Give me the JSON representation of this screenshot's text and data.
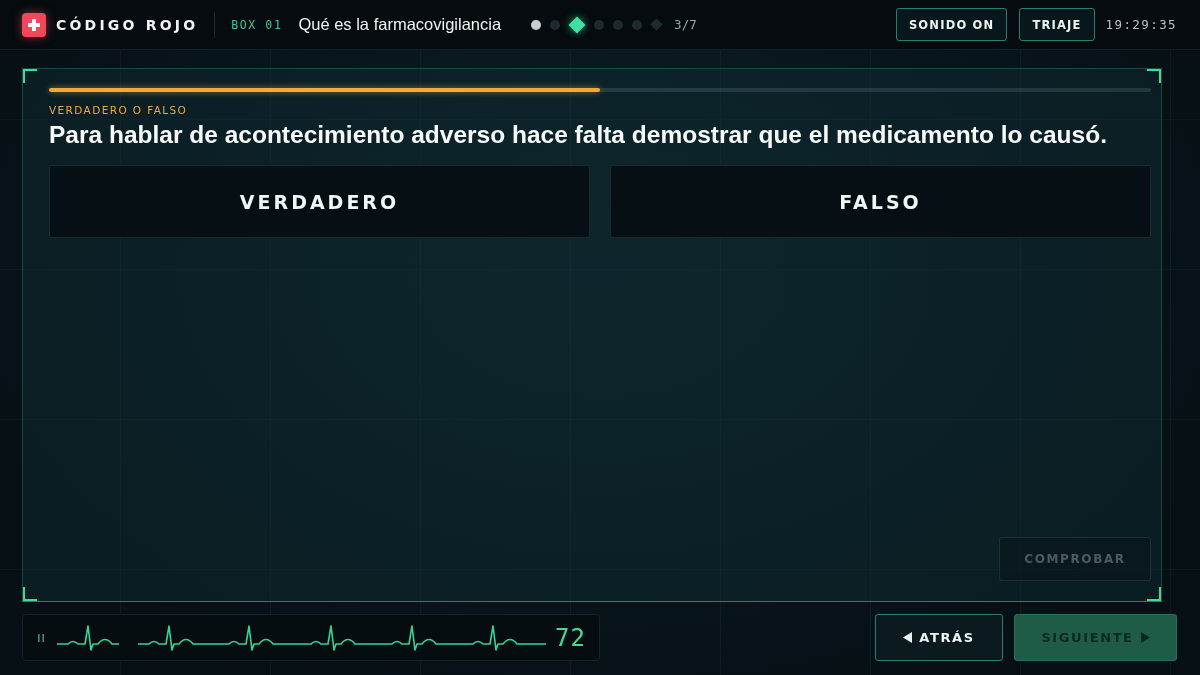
{
  "header": {
    "brand": "CÓDIGO ROJO",
    "box_label": "BOX 01",
    "topic": "Qué es la farmacovigilancia",
    "steps": [
      {
        "kind": "dot",
        "selected": false,
        "completed": true
      },
      {
        "kind": "dot",
        "selected": false,
        "completed": false
      },
      {
        "kind": "diamond",
        "selected": true,
        "completed": false
      },
      {
        "kind": "dot",
        "selected": false,
        "completed": false
      },
      {
        "kind": "dot",
        "selected": false,
        "completed": false
      },
      {
        "kind": "dot",
        "selected": false,
        "completed": false
      },
      {
        "kind": "diamond",
        "selected": false,
        "completed": false
      }
    ],
    "step_counter": "3/7",
    "sound_button": {
      "label": "SONIDO ON"
    },
    "triage_button": {
      "label": "TRIAJE"
    },
    "clock": "19:29:35"
  },
  "question": {
    "progress": {
      "level": 0.5
    },
    "type_label": "VERDADERO O FALSO",
    "text": "Para hablar de acontecimiento adverso hace falta demostrar que el medicamento lo causó.",
    "options": [
      {
        "label": "VERDADERO",
        "selected": false
      },
      {
        "label": "FALSO",
        "selected": false
      }
    ],
    "check_button": {
      "label": "COMPROBAR",
      "disabled": true
    }
  },
  "footer": {
    "heart_rate": "72",
    "back_button": {
      "label": "ATRÁS"
    },
    "next_button": {
      "label": "SIGUIENTE"
    }
  }
}
